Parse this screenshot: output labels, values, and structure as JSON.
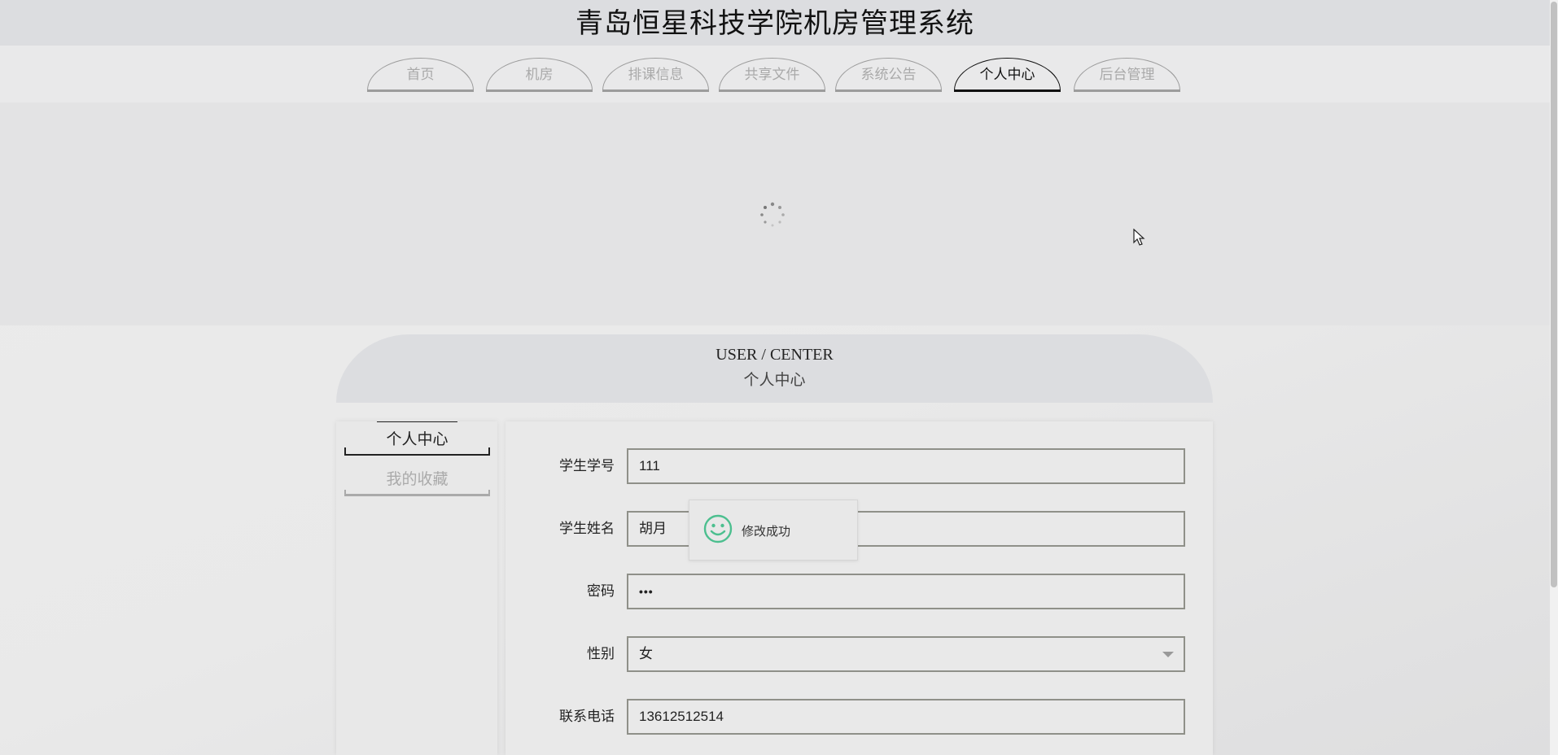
{
  "header": {
    "title": "青岛恒星科技学院机房管理系统"
  },
  "nav": {
    "tabs": [
      {
        "label": "首页",
        "active": false
      },
      {
        "label": "机房",
        "active": false
      },
      {
        "label": "排课信息",
        "active": false
      },
      {
        "label": "共享文件",
        "active": false
      },
      {
        "label": "系统公告",
        "active": false
      },
      {
        "label": "个人中心",
        "active": true
      },
      {
        "label": "后台管理",
        "active": false
      }
    ]
  },
  "section": {
    "title_en": "USER / CENTER",
    "title_cn": "个人中心"
  },
  "sidebar": {
    "items": [
      {
        "label": "个人中心",
        "active": true
      },
      {
        "label": "我的收藏",
        "active": false
      }
    ]
  },
  "form": {
    "student_id": {
      "label": "学生学号",
      "value": "111"
    },
    "student_name": {
      "label": "学生姓名",
      "value": "胡月"
    },
    "password": {
      "label": "密码",
      "value": "•••"
    },
    "gender": {
      "label": "性别",
      "value": "女"
    },
    "phone": {
      "label": "联系电话",
      "value": "13612512514"
    }
  },
  "toast": {
    "message": "修改成功",
    "icon": "smile-icon"
  },
  "colors": {
    "accent": "#111111",
    "inactive": "#a9a9a9",
    "header_bg": "#dcdde0",
    "success": "#4cbf8f"
  }
}
